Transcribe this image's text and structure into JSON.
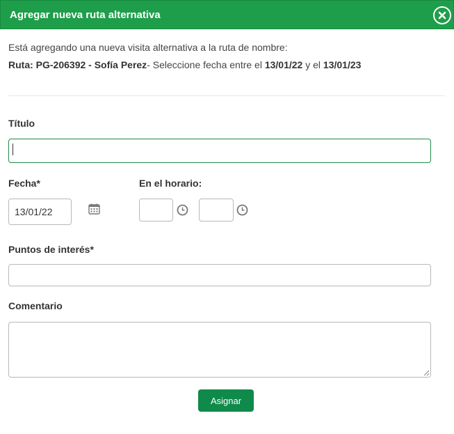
{
  "dialog": {
    "title": "Agregar nueva ruta alternativa"
  },
  "intro": {
    "line1": "Está agregando una nueva visita alternativa a la ruta de nombre:",
    "route_label": "Ruta: PG-206392 - Sofía Perez",
    "route_suffix": "- Seleccione fecha entre el ",
    "date_from": "13/01/22",
    "between": " y el ",
    "date_to": "13/01/23"
  },
  "form": {
    "title_label": "Título",
    "title_value": "",
    "date_label": "Fecha*",
    "date_value": "13/01/22",
    "schedule_label": "En el horario:",
    "time_start_value": "",
    "time_end_value": "",
    "points_label": "Puntos de interés*",
    "points_value": "",
    "comment_label": "Comentario",
    "comment_value": ""
  },
  "actions": {
    "assign_label": "Asignar"
  },
  "icons": {
    "close": "close-icon",
    "calendar": "calendar-icon",
    "clock": "clock-icon"
  },
  "colors": {
    "header": "#1e9e4a",
    "button": "#0f8a4a",
    "focus_border": "#1e8a4a"
  }
}
